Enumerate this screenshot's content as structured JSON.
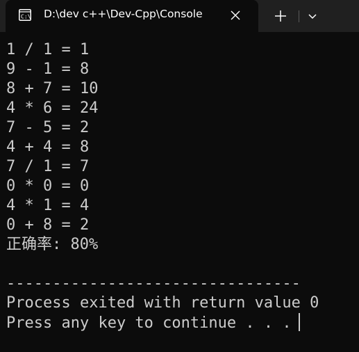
{
  "tab": {
    "title": "D:\\dev c++\\Dev-Cpp\\Console",
    "icon": "terminal-icon"
  },
  "toolbar": {
    "close_icon": "close-icon",
    "new_tab_icon": "plus-icon",
    "dropdown_icon": "chevron-down-icon"
  },
  "console": {
    "lines": [
      "1 / 1 = 1",
      "9 - 1 = 8",
      "8 + 7 = 10",
      "4 * 6 = 24",
      "7 - 5 = 2",
      "4 + 4 = 8",
      "7 / 1 = 7",
      "0 * 0 = 0",
      "4 * 1 = 4",
      "0 + 8 = 2",
      "正确率: 80%",
      "",
      "--------------------------------",
      "Process exited with return value 0",
      "Press any key to continue . . ."
    ]
  },
  "colors": {
    "background": "#0c0c0c",
    "tabbar": "#202020",
    "text": "#cccccc"
  }
}
